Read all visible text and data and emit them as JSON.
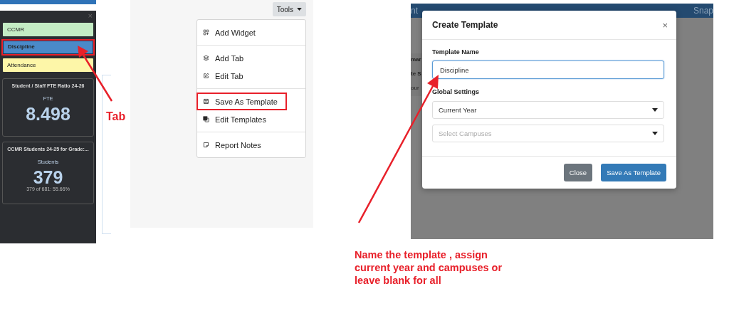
{
  "dashboard": {
    "close": "×",
    "tabs": [
      {
        "label": "CCMR",
        "color": "#c4ecc4",
        "selected": false,
        "highlighted": false
      },
      {
        "label": "Discipline",
        "color": "#4a8ac9",
        "selected": true,
        "highlighted": true
      },
      {
        "label": "Attendance",
        "color": "#fdf6a8",
        "selected": false,
        "highlighted": false
      }
    ],
    "widgets": [
      {
        "title": "Student / Staff FTE Ratio 24-26",
        "unit": "FTE",
        "value": "8.498"
      },
      {
        "title": "CCMR Students 24-25 for Grade:...",
        "unit": "Students",
        "value": "379",
        "detail": "379 of 681: 55.66%"
      }
    ]
  },
  "tab_note": "Tab",
  "tools": {
    "button": "Tools",
    "groups": [
      [
        {
          "label": "Add Widget",
          "highlighted": false
        }
      ],
      [
        {
          "label": "Add Tab",
          "highlighted": false
        },
        {
          "label": "Edit Tab",
          "highlighted": false
        }
      ],
      [
        {
          "label": "Save As Template",
          "highlighted": true
        },
        {
          "label": "Edit Templates",
          "highlighted": false
        }
      ],
      [
        {
          "label": "Report Notes",
          "highlighted": false
        }
      ]
    ]
  },
  "background": {
    "nav_left": "nt",
    "nav_right": "Snap",
    "side": [
      "mar",
      "te S",
      "our"
    ]
  },
  "dialog": {
    "title": "Create Template",
    "close": "×",
    "name_label": "Template Name",
    "name_value": "Discipline",
    "settings_label": "Global Settings",
    "selects": [
      {
        "value": "Current Year"
      },
      {
        "placeholder": "Select Campuses"
      }
    ],
    "buttons": [
      {
        "label": "Close",
        "kind": "secondary"
      },
      {
        "label": "Save As Template",
        "kind": "primary"
      }
    ]
  },
  "dialog_note": "Name the template , assign current year and campuses or leave blank for all"
}
